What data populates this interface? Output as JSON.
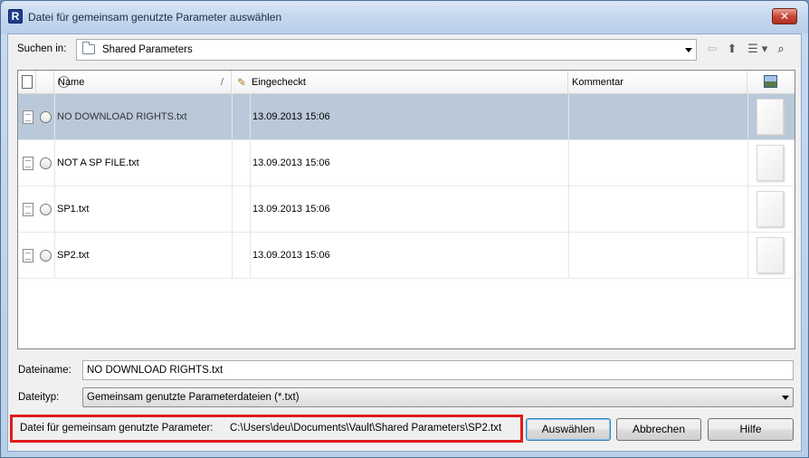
{
  "window": {
    "title": "Datei für gemeinsam genutzte Parameter auswählen",
    "app_icon_letter": "R",
    "close_glyph": "✕"
  },
  "lookin": {
    "label": "Suchen in:",
    "value": "Shared Parameters"
  },
  "toolbar": {
    "back_glyph": "⇦",
    "up_glyph": "⬆",
    "views_glyph": "☰",
    "views_arrow": "▾",
    "find_glyph": "⌕"
  },
  "columns": {
    "name": "Name",
    "sort_glyph": "/",
    "checkedout": "Eingecheckt",
    "comment": "Kommentar"
  },
  "files": [
    {
      "name": "NO DOWNLOAD RIGHTS.txt",
      "checkedout": "13.09.2013 15:06",
      "comment": ""
    },
    {
      "name": "NOT A SP FILE.txt",
      "checkedout": "13.09.2013 15:06",
      "comment": ""
    },
    {
      "name": "SP1.txt",
      "checkedout": "13.09.2013 15:06",
      "comment": ""
    },
    {
      "name": "SP2.txt",
      "checkedout": "13.09.2013 15:06",
      "comment": ""
    }
  ],
  "selected_row_index": 0,
  "filename": {
    "label": "Dateiname:",
    "value": "NO DOWNLOAD RIGHTS.txt"
  },
  "filetype": {
    "label": "Dateityp:",
    "value": "Gemeinsam genutzte Parameterdateien (*.txt)"
  },
  "shared_param": {
    "label": "Datei für gemeinsam genutzte Parameter:",
    "path": "C:\\Users\\deu\\Documents\\Vault\\Shared Parameters\\SP2.txt",
    "highlight_color": "#e01b1b"
  },
  "buttons": {
    "select": "Auswählen",
    "cancel": "Abbrechen",
    "help": "Hilfe"
  }
}
